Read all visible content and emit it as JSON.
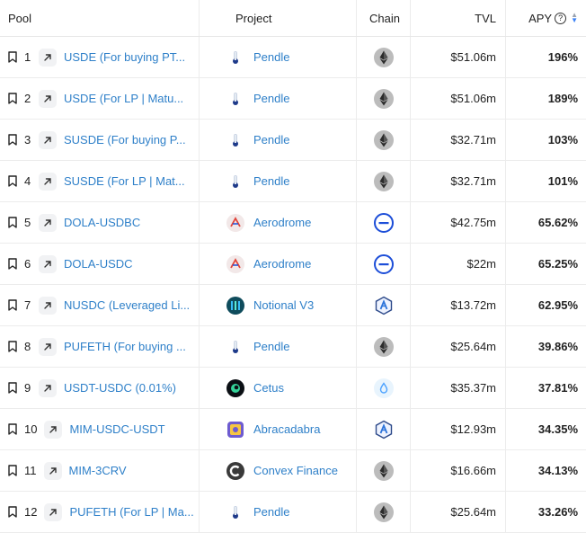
{
  "header": {
    "pool": "Pool",
    "project": "Project",
    "chain": "Chain",
    "tvl": "TVL",
    "apy": "APY",
    "help_glyph": "?"
  },
  "rows": [
    {
      "rank": "1",
      "pool": "USDE (For buying PT...",
      "project": "Pendle",
      "project_icon": "pendle",
      "chain_icon": "ethereum",
      "tvl": "$51.06m",
      "apy": "196%"
    },
    {
      "rank": "2",
      "pool": "USDE (For LP | Matu...",
      "project": "Pendle",
      "project_icon": "pendle",
      "chain_icon": "ethereum",
      "tvl": "$51.06m",
      "apy": "189%"
    },
    {
      "rank": "3",
      "pool": "SUSDE (For buying P...",
      "project": "Pendle",
      "project_icon": "pendle",
      "chain_icon": "ethereum",
      "tvl": "$32.71m",
      "apy": "103%"
    },
    {
      "rank": "4",
      "pool": "SUSDE (For LP | Mat...",
      "project": "Pendle",
      "project_icon": "pendle",
      "chain_icon": "ethereum",
      "tvl": "$32.71m",
      "apy": "101%"
    },
    {
      "rank": "5",
      "pool": "DOLA-USDBC",
      "project": "Aerodrome",
      "project_icon": "aerodrome",
      "chain_icon": "base",
      "tvl": "$42.75m",
      "apy": "65.62%"
    },
    {
      "rank": "6",
      "pool": "DOLA-USDC",
      "project": "Aerodrome",
      "project_icon": "aerodrome",
      "chain_icon": "base",
      "tvl": "$22m",
      "apy": "65.25%"
    },
    {
      "rank": "7",
      "pool": "NUSDC (Leveraged Li...",
      "project": "Notional V3",
      "project_icon": "notional",
      "chain_icon": "arbitrum",
      "tvl": "$13.72m",
      "apy": "62.95%"
    },
    {
      "rank": "8",
      "pool": "PUFETH (For buying ...",
      "project": "Pendle",
      "project_icon": "pendle",
      "chain_icon": "ethereum",
      "tvl": "$25.64m",
      "apy": "39.86%"
    },
    {
      "rank": "9",
      "pool": "USDT-USDC (0.01%)",
      "project": "Cetus",
      "project_icon": "cetus",
      "chain_icon": "sui",
      "tvl": "$35.37m",
      "apy": "37.81%"
    },
    {
      "rank": "10",
      "pool": "MIM-USDC-USDT",
      "project": "Abracadabra",
      "project_icon": "abracadabra",
      "chain_icon": "arbitrum",
      "tvl": "$12.93m",
      "apy": "34.35%"
    },
    {
      "rank": "11",
      "pool": "MIM-3CRV",
      "project": "Convex Finance",
      "project_icon": "convex",
      "chain_icon": "ethereum",
      "tvl": "$16.66m",
      "apy": "34.13%"
    },
    {
      "rank": "12",
      "pool": "PUFETH (For LP | Ma...",
      "project": "Pendle",
      "project_icon": "pendle",
      "chain_icon": "ethereum",
      "tvl": "$25.64m",
      "apy": "33.26%"
    }
  ],
  "colors": {
    "link": "#2f80c9",
    "sort_accent": "#3b82f6"
  }
}
